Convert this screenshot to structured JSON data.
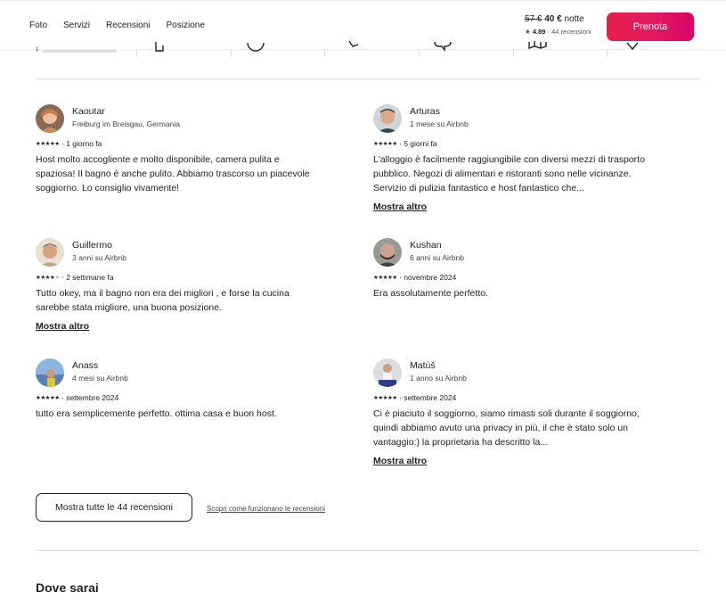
{
  "nav": {
    "links": [
      "Foto",
      "Servizi",
      "Recensioni",
      "Posizione"
    ],
    "price_old": "57 €",
    "price_new": "40 €",
    "price_unit": "notte",
    "rating": "4.89",
    "reviews_count": "44 recensioni",
    "reserve_label": "Prenota",
    "brand_color": "#e31c5f"
  },
  "category_strip": {
    "first_value": "1"
  },
  "reviews": [
    {
      "name": "Kaoutar",
      "subtitle": "Freiburg im Breisgau, Germania",
      "rating": 5,
      "stars": "★★★★★",
      "when": "1 giorno fa",
      "text": "Host molto accogliente e molto disponibile, camera pulita e spaziosa! Il bagno è anche pulito. Abbiamo trascorso un piacevole soggiorno. Lo consiglio vivamente!",
      "more": ""
    },
    {
      "name": "Arturas",
      "subtitle": "1 mese su Airbnb",
      "rating": 5,
      "stars": "★★★★★",
      "when": "5 giorni fa",
      "text": "L'alloggio è facilmente raggiungibile con diversi mezzi di trasporto pubblico. Negozi di alimentari e ristoranti sono nelle vicinanze. Servizio di pulizia fantastico e host fantastico che...",
      "more": "Mostra altro"
    },
    {
      "name": "Guillermo",
      "subtitle": "3 anni su Airbnb",
      "rating": 4,
      "stars": "★★★★",
      "when": "2 settimane fa",
      "text": "Tutto okey, ma il bagno non era dei migliori , e forse la cucina sarebbe stata migliore, una buona posizione.",
      "more": "Mostra altro"
    },
    {
      "name": "Kushan",
      "subtitle": "6 anni su Airbnb",
      "rating": 5,
      "stars": "★★★★★",
      "when": "novembre 2024",
      "text": "Era assolutamente perfetto.",
      "more": ""
    },
    {
      "name": "Anass",
      "subtitle": "4 mesi su Airbnb",
      "rating": 5,
      "stars": "★★★★★",
      "when": "settembre 2024",
      "text": "tutto era semplicemente perfetto. ottima casa e buon host.",
      "more": ""
    },
    {
      "name": "Matúš",
      "subtitle": "1 anno su Airbnb",
      "rating": 5,
      "stars": "★★★★★",
      "when": "settembre 2024",
      "text": "Ci è piaciuto il soggiorno, siamo rimasti soli durante il soggiorno, quindi abbiamo avuto una privacy in più, il che è stato solo un vantaggio:) la proprietaria ha descritto la...",
      "more": "Mostra altro"
    }
  ],
  "actions": {
    "show_all": "Mostra tutte le 44 recensioni",
    "how_reviews_work": "Scopri come funzionano le recensioni"
  },
  "section_where": "Dove sarai"
}
